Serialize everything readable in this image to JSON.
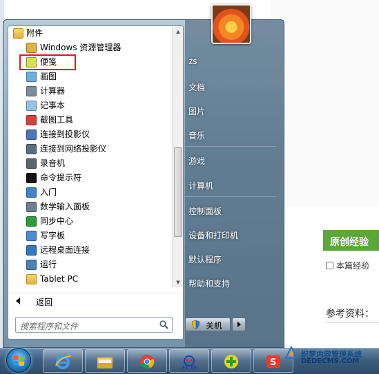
{
  "start_menu": {
    "programs": [
      {
        "label": "附件",
        "kind": "folder-root",
        "icon": "folder-icon"
      },
      {
        "label": "Windows 资源管理器",
        "kind": "child",
        "icon": "explorer-icon"
      },
      {
        "label": "便笺",
        "kind": "child",
        "icon": "sticky-notes-icon",
        "highlighted": true
      },
      {
        "label": "画图",
        "kind": "child",
        "icon": "paint-icon"
      },
      {
        "label": "计算器",
        "kind": "child",
        "icon": "calculator-icon"
      },
      {
        "label": "记事本",
        "kind": "child",
        "icon": "notepad-icon"
      },
      {
        "label": "截图工具",
        "kind": "child",
        "icon": "snipping-tool-icon"
      },
      {
        "label": "连接到投影仪",
        "kind": "child",
        "icon": "projector-icon"
      },
      {
        "label": "连接到网络投影仪",
        "kind": "child",
        "icon": "network-projector-icon"
      },
      {
        "label": "录音机",
        "kind": "child",
        "icon": "microphone-icon"
      },
      {
        "label": "命令提示符",
        "kind": "child",
        "icon": "command-prompt-icon"
      },
      {
        "label": "入门",
        "kind": "child",
        "icon": "getting-started-icon"
      },
      {
        "label": "数学输入面板",
        "kind": "child",
        "icon": "math-input-icon"
      },
      {
        "label": "同步中心",
        "kind": "child",
        "icon": "sync-center-icon"
      },
      {
        "label": "写字板",
        "kind": "child",
        "icon": "wordpad-icon"
      },
      {
        "label": "远程桌面连接",
        "kind": "child",
        "icon": "remote-desktop-icon"
      },
      {
        "label": "运行",
        "kind": "child",
        "icon": "run-icon"
      },
      {
        "label": "Tablet PC",
        "kind": "subfolder",
        "icon": "folder-icon"
      }
    ],
    "back_label": "返回",
    "search_placeholder": "搜索程序和文件",
    "right_items": [
      {
        "label": "zs"
      },
      {
        "label": "文档"
      },
      {
        "label": "图片"
      },
      {
        "label": "音乐"
      },
      {
        "label": "游戏"
      },
      {
        "label": "计算机"
      },
      {
        "label": "控制面板"
      },
      {
        "label": "设备和打印机"
      },
      {
        "label": "默认程序"
      },
      {
        "label": "帮助和支持"
      }
    ],
    "shutdown_label": "关机"
  },
  "background_page": {
    "green_box_text": "原创经验",
    "checkbox_text": "本篇经验",
    "reference_text": "参考资料：",
    "watermark_line1": "织梦内容管理系统",
    "watermark_line2": "DEDECMS.COM"
  },
  "colors": {
    "highlight_box": "#e0141e",
    "green_box": "#5aa73a"
  }
}
